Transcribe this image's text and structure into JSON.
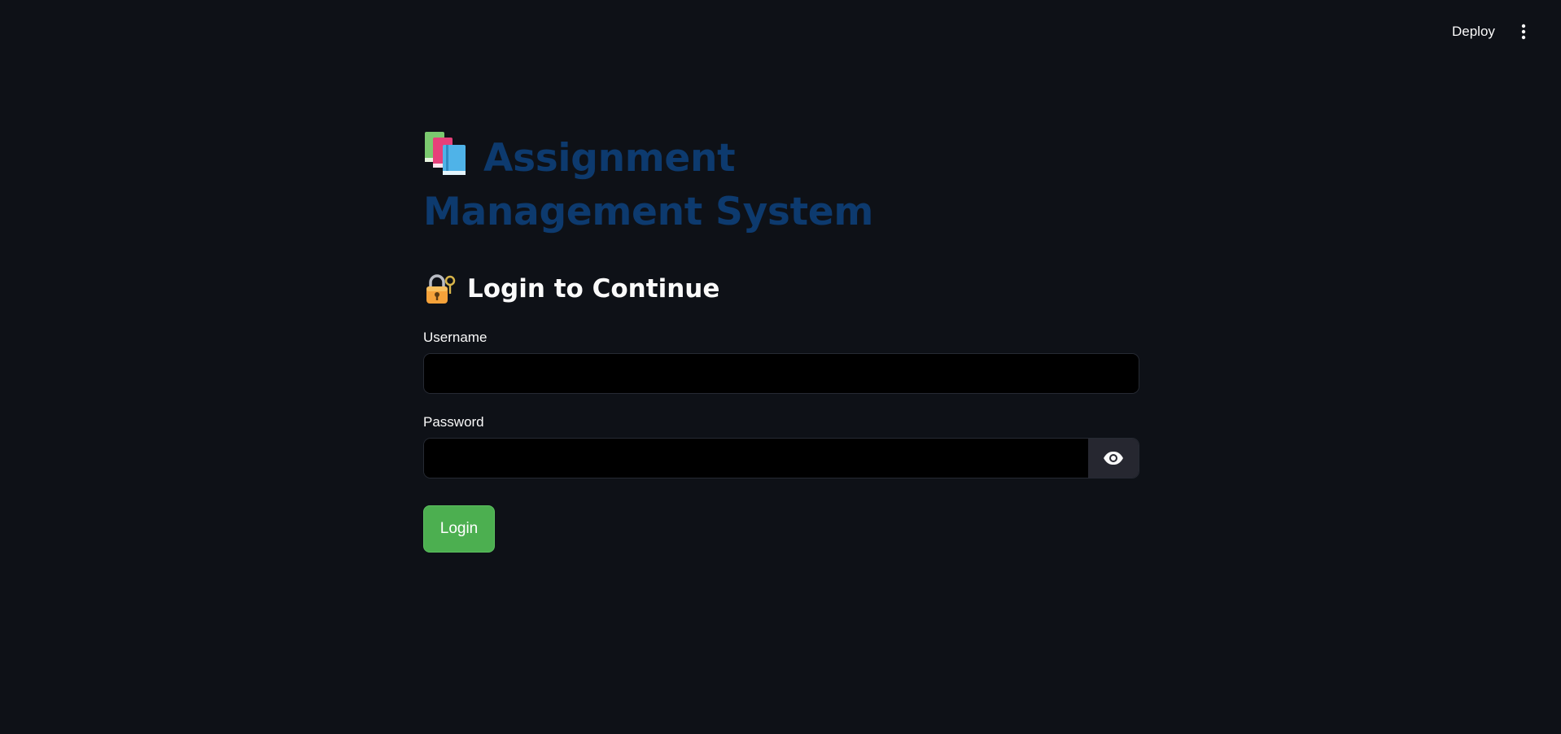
{
  "header": {
    "deploy_label": "Deploy",
    "menu_icon": "vertical-ellipsis-icon"
  },
  "main": {
    "title": "Assignment Management System",
    "title_icon": "books-icon",
    "title_color": "#0d3a6e",
    "subheading": "Login to Continue",
    "subheading_icon": "lock-with-key-icon",
    "username": {
      "label": "Username",
      "value": ""
    },
    "password": {
      "label": "Password",
      "value": "",
      "toggle_icon": "eye-icon"
    },
    "login_button": {
      "label": "Login",
      "color": "#4caf50"
    }
  },
  "colors": {
    "background": "#0e1117",
    "input_background": "#000000",
    "text": "#fafafa"
  }
}
